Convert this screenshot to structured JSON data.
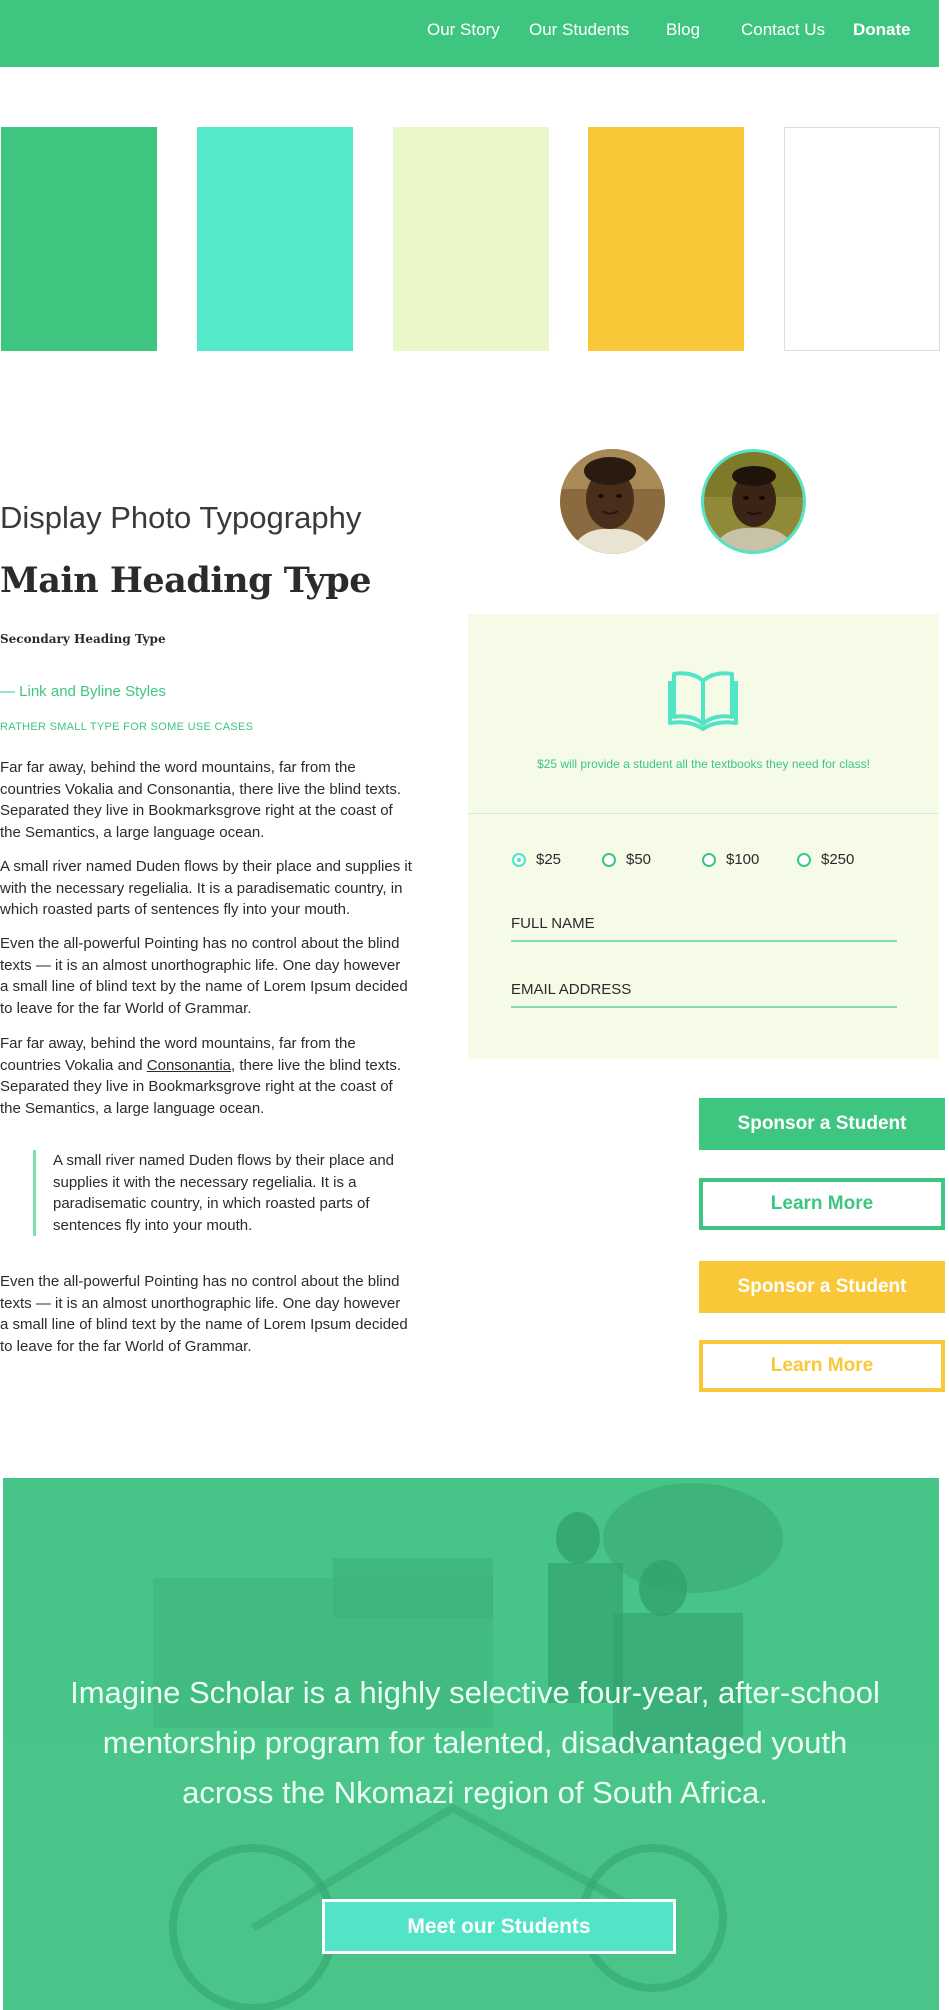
{
  "nav": {
    "items": [
      {
        "label": "Our Story"
      },
      {
        "label": "Our Students"
      },
      {
        "label": "Blog"
      },
      {
        "label": "Contact Us"
      },
      {
        "label": "Donate"
      }
    ]
  },
  "palette": {
    "swatches": [
      "#3ec680",
      "#53e9c9",
      "#eaf8c9",
      "#f9c737",
      "#ffffff"
    ]
  },
  "typography": {
    "display": "Display Photo Typography",
    "main_heading": "Main Heading Type",
    "secondary_heading": "Secondary Heading Type",
    "link_byline": "— Link and Byline Styles",
    "small_caps": "RATHER SMALL TYPE FOR SOME USE CASES",
    "paragraphs": [
      "Far far away, behind the word mountains, far from the countries Vokalia and Consonantia, there live the blind texts. Separated they live in Bookmarksgrove right at the coast of the Semantics, a large language ocean.",
      "A small river named Duden flows by their place and supplies it with the necessary regelialia. It is a paradisematic country, in which roasted parts of sentences fly into your mouth.",
      "Even the all-powerful Pointing has no control about the blind texts — it is an almost unorthographic life. One day however a small line of blind text by the name of Lorem Ipsum decided to leave for the far World of Grammar."
    ],
    "para4_before": "Far far away, behind the word mountains, far from the countries Vokalia and ",
    "para4_link": "Consonantia",
    "para4_after": ", there live the blind texts. Separated they live in Bookmarksgrove right at the coast of the Semantics, a large language ocean.",
    "blockquote": "A small river named Duden flows by their place and supplies it with the necessary regelialia. It is a paradisematic country, in which roasted parts of sentences fly into your mouth.",
    "para_last": "Even the all-powerful Pointing has no control about the blind texts — it is an almost unorthographic life. One day however a small line of blind text by the name of Lorem Ipsum decided to leave for the far World of Grammar."
  },
  "donation": {
    "icon": "open-book-icon",
    "caption": "$25 will provide a student all the textbooks they need for class!",
    "amounts": [
      "$25",
      "$50",
      "$100",
      "$250"
    ],
    "selected": "$25",
    "full_name_placeholder": "FULL NAME",
    "email_placeholder": "EMAIL ADDRESS"
  },
  "buttons": {
    "sponsor_green": "Sponsor a Student",
    "learn_green": "Learn More",
    "sponsor_yellow": "Sponsor a Student",
    "learn_yellow": "Learn More"
  },
  "hero": {
    "text": "Imagine Scholar is a highly selective four-year, after-school mentorship program for talented, disadvantaged youth across the Nkomazi region of South Africa.",
    "cta": "Meet our Students"
  },
  "colors": {
    "primary_green": "#3ec680",
    "aqua": "#53e3c6",
    "yellow": "#f9c737",
    "panel_bg": "#f6fbe7"
  }
}
